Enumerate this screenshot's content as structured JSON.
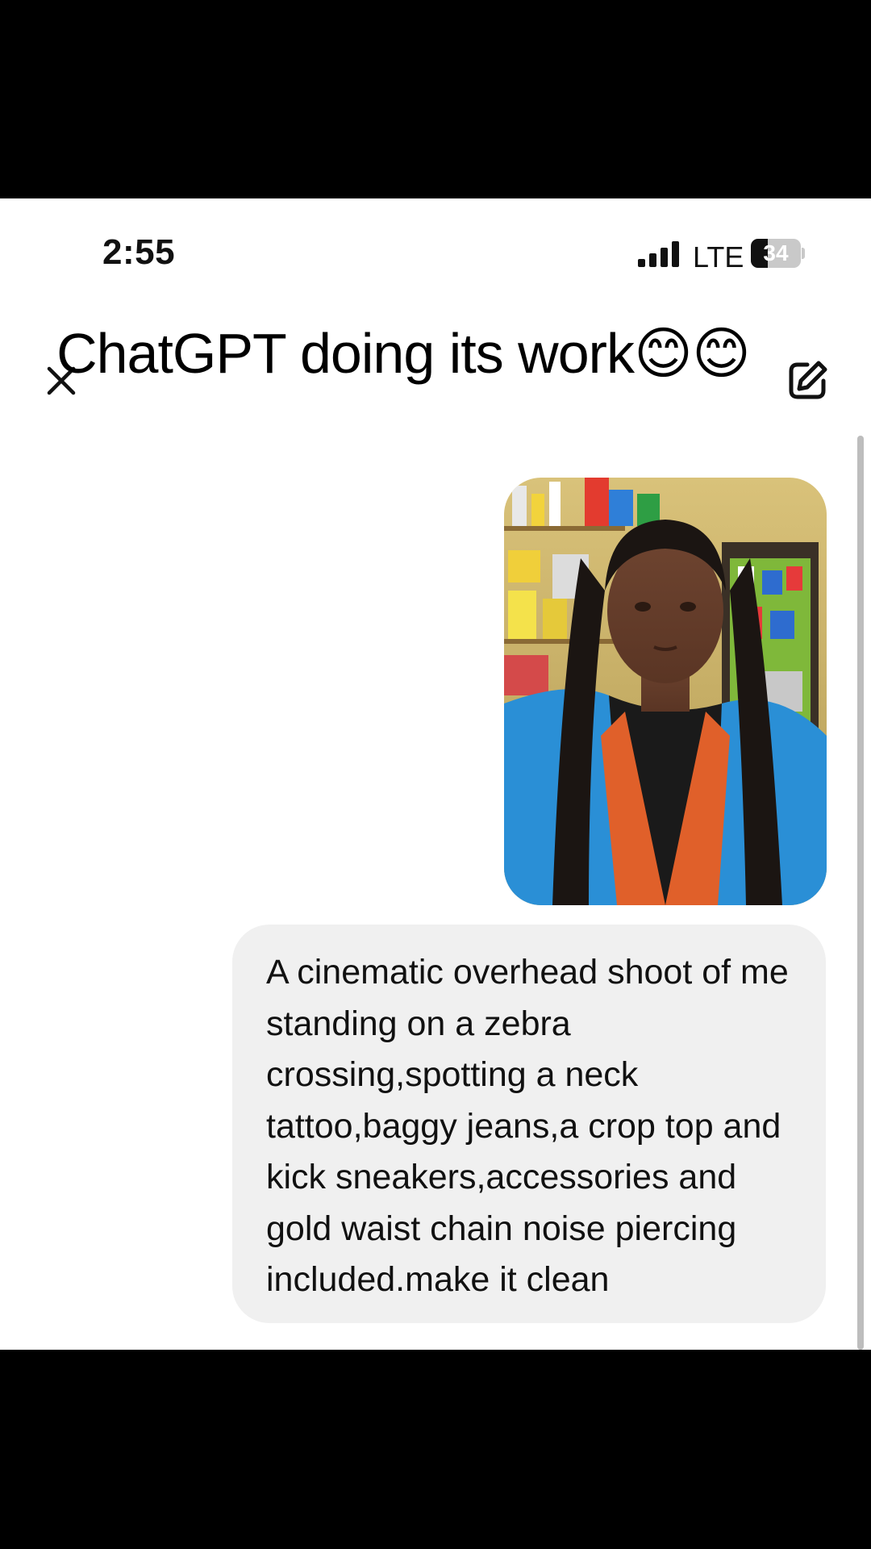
{
  "status_bar": {
    "time": "2:55",
    "network": "LTE",
    "battery": "34",
    "battery_level": 0.34
  },
  "caption": {
    "text": "ChatGPT doing its work😊😊"
  },
  "toolbar": {
    "close_icon": "close-icon",
    "edit_icon": "edit-icon"
  },
  "chat": {
    "message": "A cinematic overhead shoot of me standing on a zebra crossing,spotting a neck tattoo,baggy jeans,a crop top and kick sneakers,accessories and gold waist chain noise piercing included.make it clean"
  }
}
